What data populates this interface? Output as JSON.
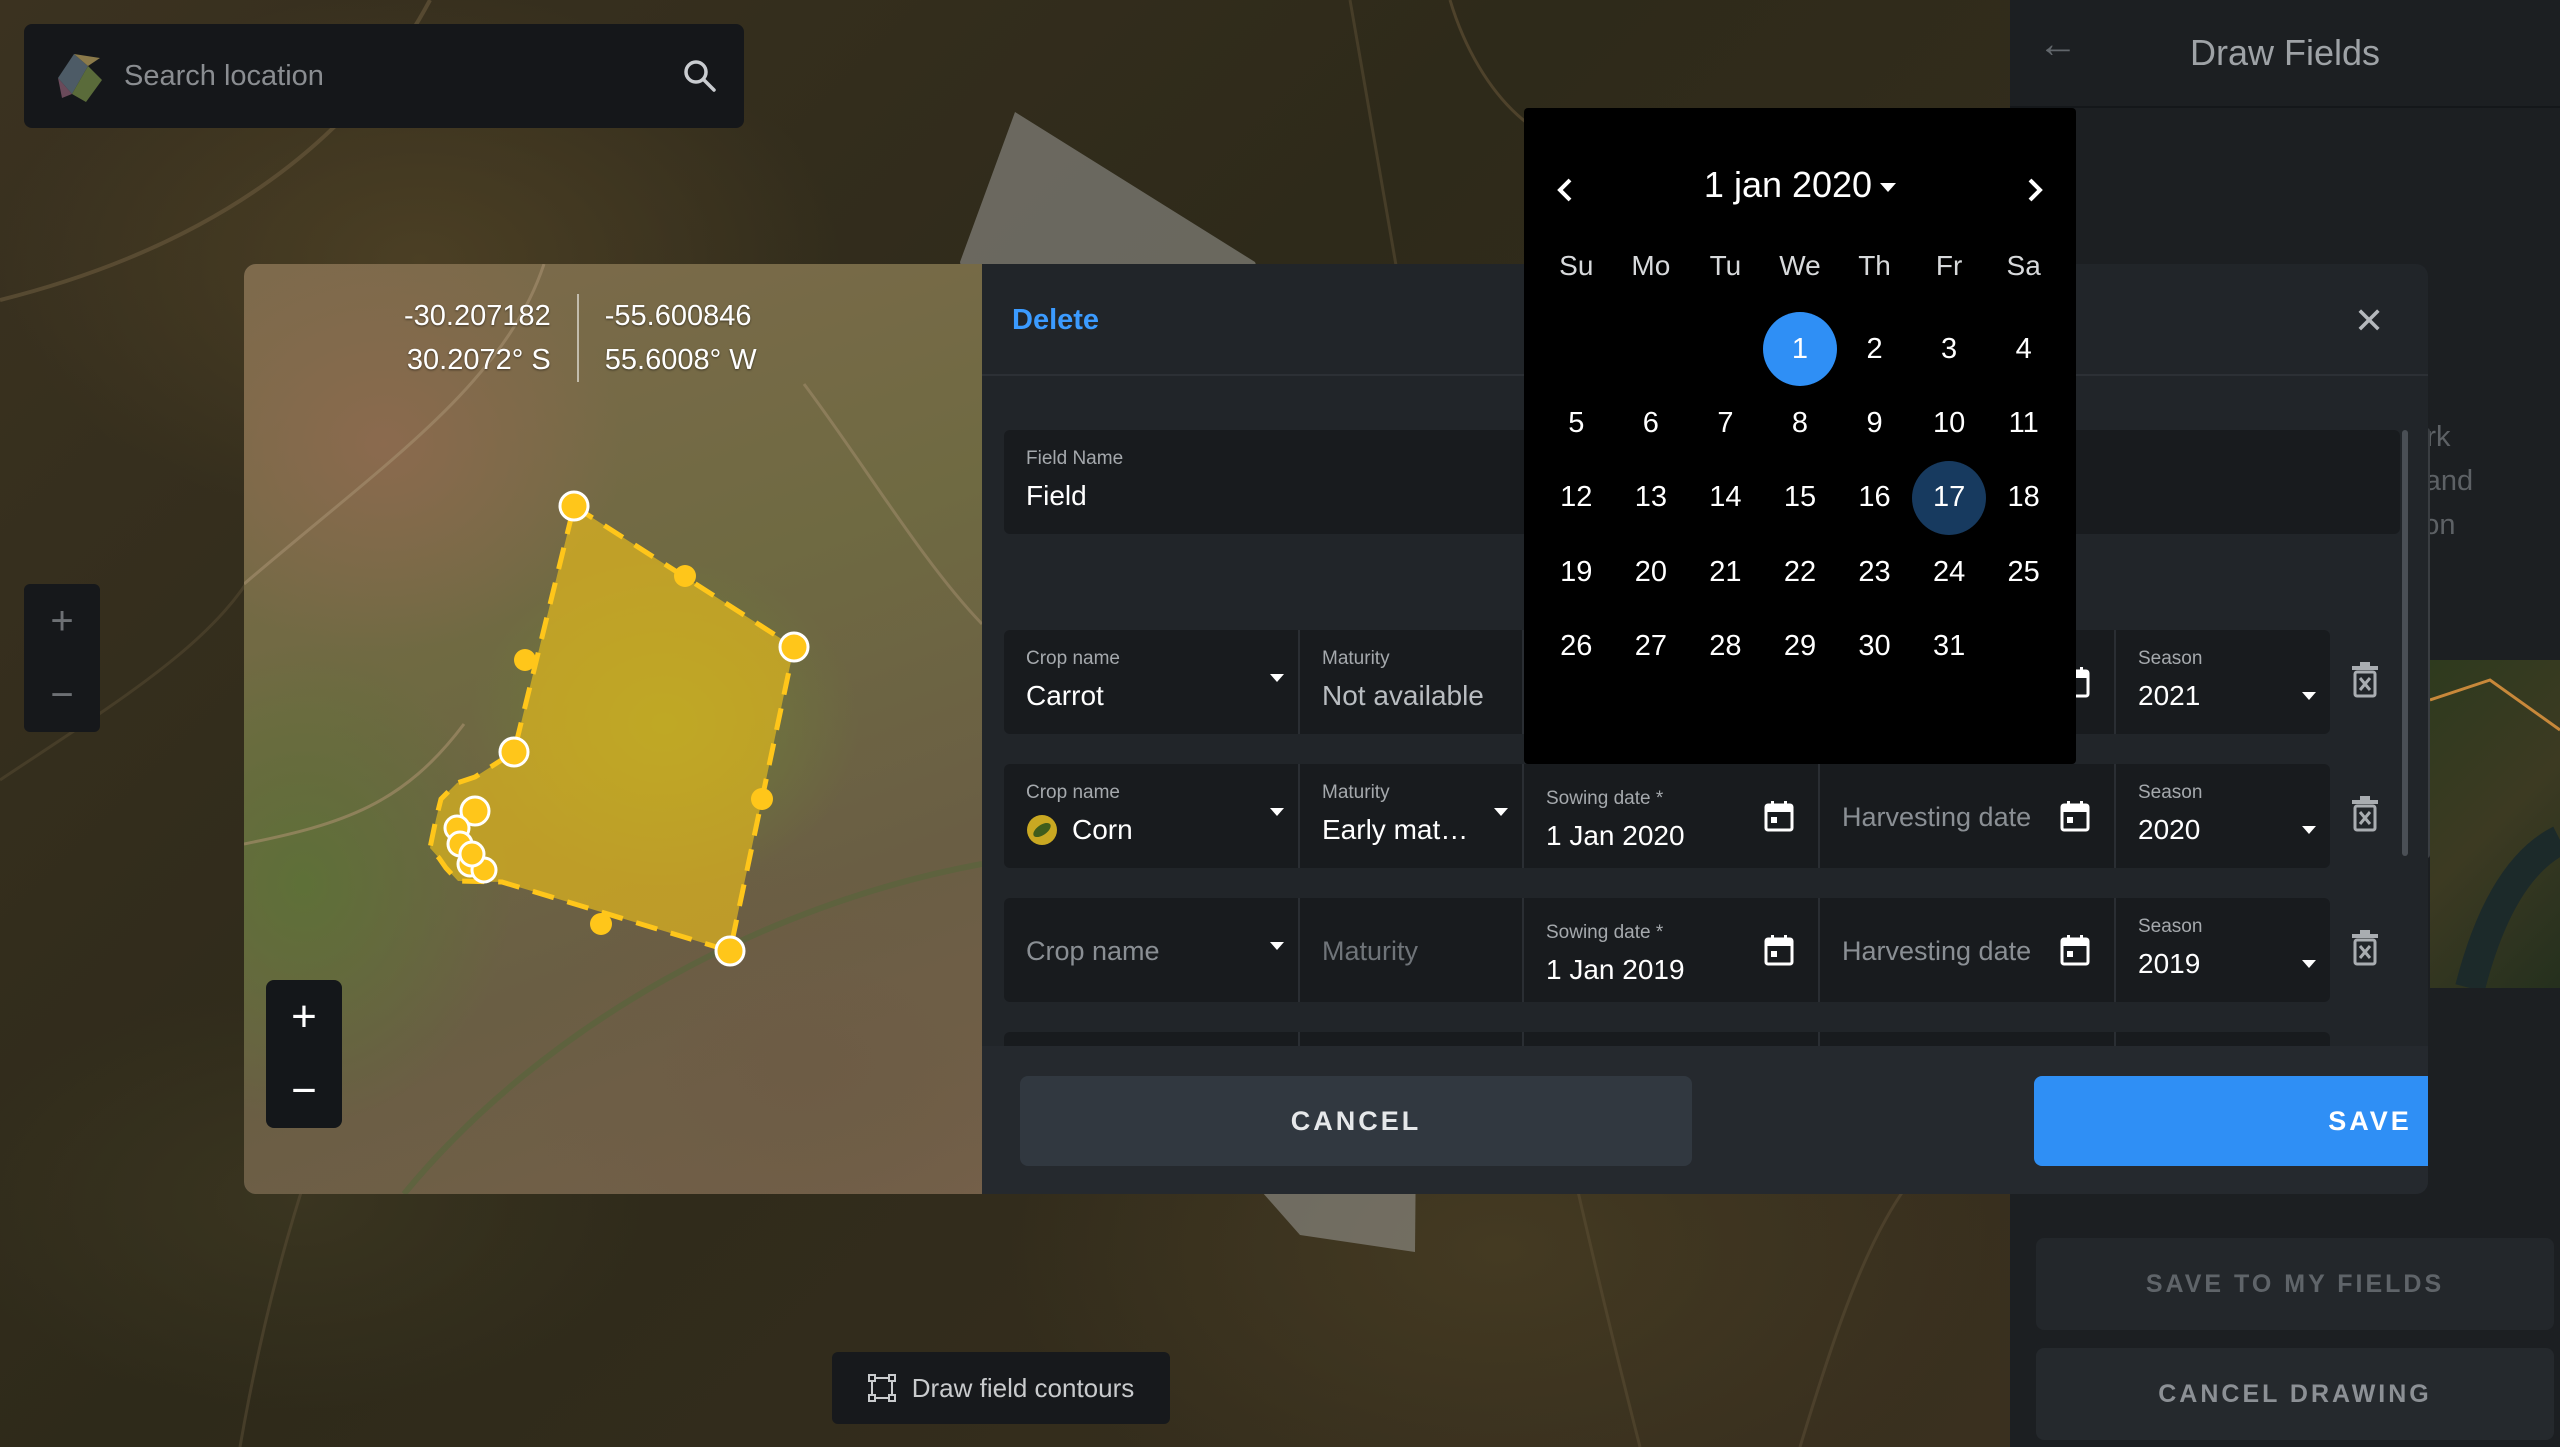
{
  "search": {
    "placeholder": "Search location"
  },
  "bg_zoom": {
    "plus": "+",
    "minus": "−"
  },
  "draw_contours": {
    "label": "Draw field contours"
  },
  "right_panel": {
    "title": "Draw Fields",
    "instructions": [
      ", mark",
      "ots, and",
      "olygon"
    ],
    "save_to_fields": "SAVE TO MY FIELDS",
    "cancel_drawing": "CANCEL DRAWING"
  },
  "modal": {
    "delete_label": "Delete",
    "close_glyph": "✕",
    "coords": {
      "lat_decimal": "-30.207182",
      "lat_dms": "30.2072° S",
      "lng_decimal": "-55.600846",
      "lng_dms": "55.6008° W"
    },
    "map_zoom": {
      "plus": "+",
      "minus": "−"
    },
    "field_name": {
      "label": "Field Name",
      "value": "Field"
    },
    "rows": [
      {
        "crop_label": "Crop name",
        "crop_value": "Carrot",
        "maturity_label": "Maturity",
        "maturity_value": "Not available",
        "season_label": "Season",
        "season_value": "2021"
      },
      {
        "crop_label": "Crop name",
        "crop_value": "Corn",
        "maturity_label": "Maturity",
        "maturity_value": "Early matur...",
        "sowing_label": "Sowing date *",
        "sowing_value": "1 Jan 2020",
        "harvest_placeholder": "Harvesting date",
        "season_label": "Season",
        "season_value": "2020"
      },
      {
        "crop_placeholder": "Crop name",
        "maturity_placeholder": "Maturity",
        "sowing_label": "Sowing date *",
        "sowing_value": "1 Jan 2019",
        "harvest_placeholder": "Harvesting date",
        "season_label": "Season",
        "season_value": "2019"
      }
    ],
    "cancel_label": "CANCEL",
    "save_label": "SAVE"
  },
  "calendar": {
    "title": "1 jan 2020",
    "weekdays": [
      "Su",
      "Mo",
      "Tu",
      "We",
      "Th",
      "Fr",
      "Sa"
    ],
    "days": [
      "",
      "",
      "",
      "1",
      "2",
      "3",
      "4",
      "5",
      "6",
      "7",
      "8",
      "9",
      "10",
      "11",
      "12",
      "13",
      "14",
      "15",
      "16",
      "17",
      "18",
      "19",
      "20",
      "21",
      "22",
      "23",
      "24",
      "25",
      "26",
      "27",
      "28",
      "29",
      "30",
      "31",
      ""
    ],
    "selected_day": "1",
    "highlighted_day": "17"
  },
  "colors": {
    "accent": "#2f8ff5",
    "polygon_fill": "#f5c518",
    "polygon_vertex": "#ffc61a",
    "calendar_hover": "#173a5f"
  }
}
